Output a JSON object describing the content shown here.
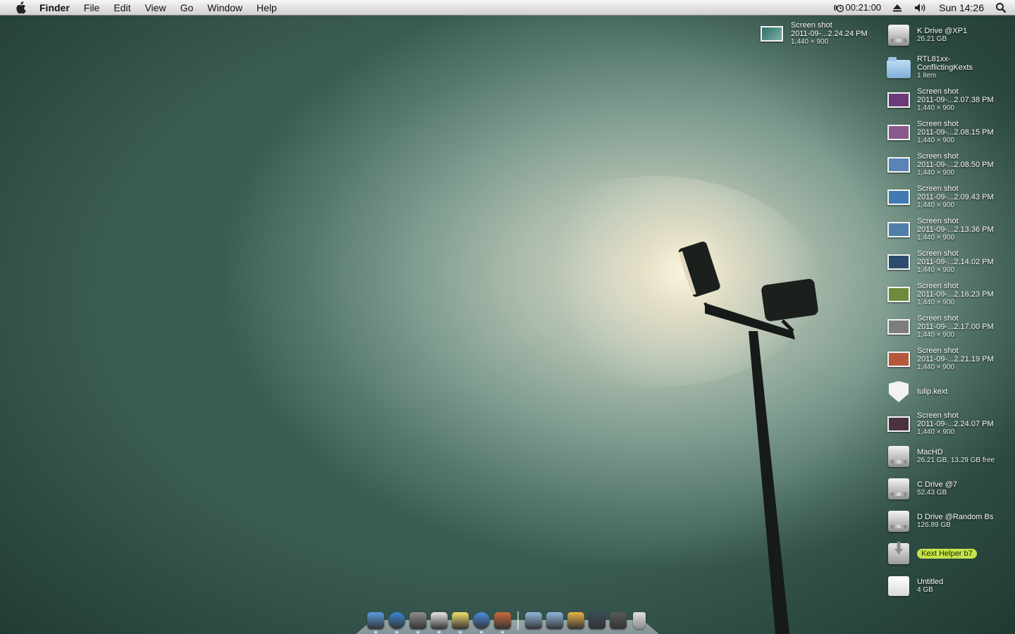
{
  "menubar": {
    "apple_icon": "apple-logo-icon",
    "app_name": "Finder",
    "menus": [
      "File",
      "Edit",
      "View",
      "Go",
      "Window",
      "Help"
    ],
    "timer": "00:21:00",
    "clock": "Sun 14:26"
  },
  "desktop": {
    "top_left_item": {
      "name_line1": "Screen shot",
      "name_line2": "2011-09-...2.24.24 PM",
      "info": "1,440 × 900"
    },
    "items": [
      {
        "kind": "drive",
        "line1": "K Drive @XP1",
        "line2": "",
        "info": "26.21 GB"
      },
      {
        "kind": "folder",
        "line1": "RTL81xx-",
        "line2": "ConflictingKexts",
        "info": "1 item"
      },
      {
        "kind": "shot",
        "color": "#6b3a7a",
        "line1": "Screen shot",
        "line2": "2011-09-...2.07.38 PM",
        "info": "1,440 × 900"
      },
      {
        "kind": "shot",
        "color": "#8a5a8f",
        "line1": "Screen shot",
        "line2": "2011-09-...2.08.15 PM",
        "info": "1,440 × 900"
      },
      {
        "kind": "shot",
        "color": "#5a84b8",
        "line1": "Screen shot",
        "line2": "2011-09-...2.08.50 PM",
        "info": "1,440 × 900"
      },
      {
        "kind": "shot",
        "color": "#3f7bb0",
        "line1": "Screen shot",
        "line2": "2011-09-...2.09.43 PM",
        "info": "1,440 × 900"
      },
      {
        "kind": "shot",
        "color": "#4f7fa8",
        "line1": "Screen shot",
        "line2": "2011-09-...2.13.36 PM",
        "info": "1,440 × 900"
      },
      {
        "kind": "shot",
        "color": "#2e4c6e",
        "line1": "Screen shot",
        "line2": "2011-09-...2.14.02 PM",
        "info": "1,440 × 900"
      },
      {
        "kind": "shot",
        "color": "#6e8a3a",
        "line1": "Screen shot",
        "line2": "2011-09-...2.16.23 PM",
        "info": "1,440 × 900"
      },
      {
        "kind": "shot",
        "color": "#7d7d7d",
        "line1": "Screen shot",
        "line2": "2011-09-...2.17.00 PM",
        "info": "1,440 × 900"
      },
      {
        "kind": "shot",
        "color": "#b5573a",
        "line1": "Screen shot",
        "line2": "2011-09-...2.21.19 PM",
        "info": "1,440 × 900"
      },
      {
        "kind": "kext",
        "line1": "tulip.kext",
        "line2": "",
        "info": ""
      },
      {
        "kind": "shot",
        "color": "#4a3040",
        "line1": "Screen shot",
        "line2": "2011-09-...2.24.07 PM",
        "info": "1,440 × 900"
      },
      {
        "kind": "drive",
        "line1": "MacHD",
        "line2": "",
        "info": "26.21 GB, 13.29 GB free"
      },
      {
        "kind": "drive",
        "line1": "C Drive @7",
        "line2": "",
        "info": "52.43 GB"
      },
      {
        "kind": "drive",
        "line1": "D Drive @Random Bs",
        "line2": "",
        "info": "126.89 GB"
      },
      {
        "kind": "installer",
        "line1": "Kext Helper b7",
        "line2": "",
        "info": "",
        "tagged": true
      },
      {
        "kind": "whitedisk",
        "line1": "Untitled",
        "line2": "",
        "info": "4 GB"
      }
    ]
  },
  "dock": {
    "apps": [
      {
        "name": "finder",
        "color": "#5a9be0",
        "running": true
      },
      {
        "name": "safari",
        "color": "#3b86d6",
        "running": true
      },
      {
        "name": "system-preferences",
        "color": "#8d8d8d",
        "running": true
      },
      {
        "name": "preview",
        "color": "#e6e6e6",
        "running": true
      },
      {
        "name": "stickies",
        "color": "#f2e06a",
        "running": true
      },
      {
        "name": "itunes",
        "color": "#4a8fe0",
        "running": true
      },
      {
        "name": "iphoto",
        "color": "#c96b3a",
        "running": true
      }
    ],
    "stacks": [
      {
        "name": "applications-stack",
        "color": "#8fb8e0"
      },
      {
        "name": "documents-stack",
        "color": "#8fb8e0"
      },
      {
        "name": "downloads-stack",
        "color": "#e8b34a"
      },
      {
        "name": "screen-stack-1",
        "color": "#3b4a5a"
      },
      {
        "name": "screen-stack-2",
        "color": "#5a5a5a"
      },
      {
        "name": "trash",
        "color": "#b5b5b5"
      }
    ]
  }
}
